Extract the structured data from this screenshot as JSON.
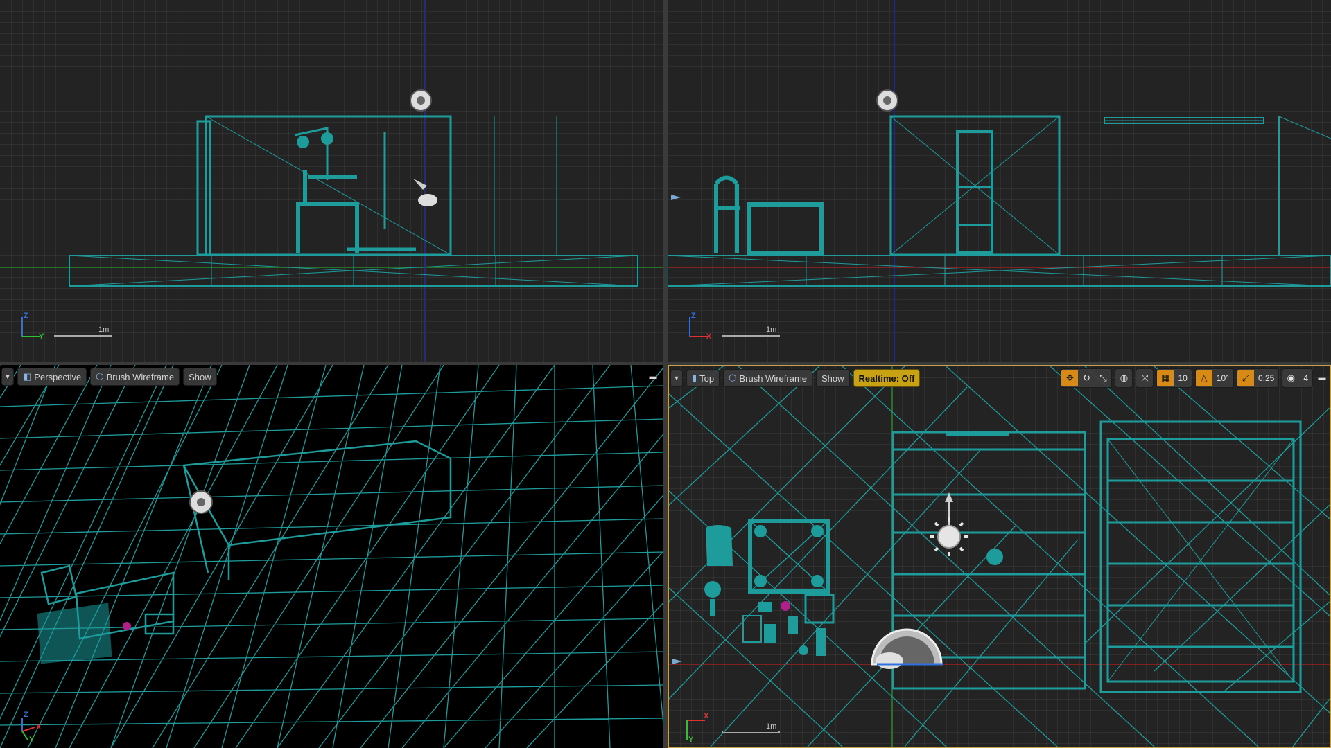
{
  "viewports": {
    "side": {
      "scale_label": "1m",
      "axis_up": "Z",
      "axis_right": "Y"
    },
    "front": {
      "scale_label": "1m",
      "axis_up": "Z",
      "axis_right": "X"
    },
    "perspective": {
      "view_mode_label": "Perspective",
      "render_mode_label": "Brush Wireframe",
      "show_label": "Show",
      "axis_up": "Z",
      "axis_right": "X",
      "axis_left": "Y"
    },
    "top": {
      "view_mode_label": "Top",
      "render_mode_label": "Brush Wireframe",
      "show_label": "Show",
      "realtime_label": "Realtime: Off",
      "grid_snap_value": "10",
      "rotation_snap_value": "10°",
      "scale_snap_value": "0.25",
      "camera_speed_value": "4",
      "scale_label": "1m",
      "axis_right": "X",
      "axis_down": "Y"
    }
  },
  "colors": {
    "wireframe": "#1e9c9c",
    "realtime_accent": "#c9a213",
    "snap_accent": "#d88a16",
    "axis_x": "#e03030",
    "axis_y": "#30c030",
    "axis_z": "#3070e0",
    "active_border": "#c8a04a"
  },
  "icons": {
    "toolbar_dropdown": "chevron-down-icon",
    "perspective": "perspective-cube-icon",
    "wireframe": "wireframe-cube-icon",
    "top": "camera-top-icon",
    "maximize": "maximize-icon",
    "translate_snap": "move-icon",
    "rotate_snap": "rotate-icon",
    "scale_snap": "scale-icon",
    "world_local": "globe-icon",
    "surface_snap": "surface-snap-icon",
    "grid": "grid-icon",
    "angle": "angle-icon",
    "scale_arrow": "scale-arrow-icon",
    "camera_speed": "camera-speed-icon"
  }
}
